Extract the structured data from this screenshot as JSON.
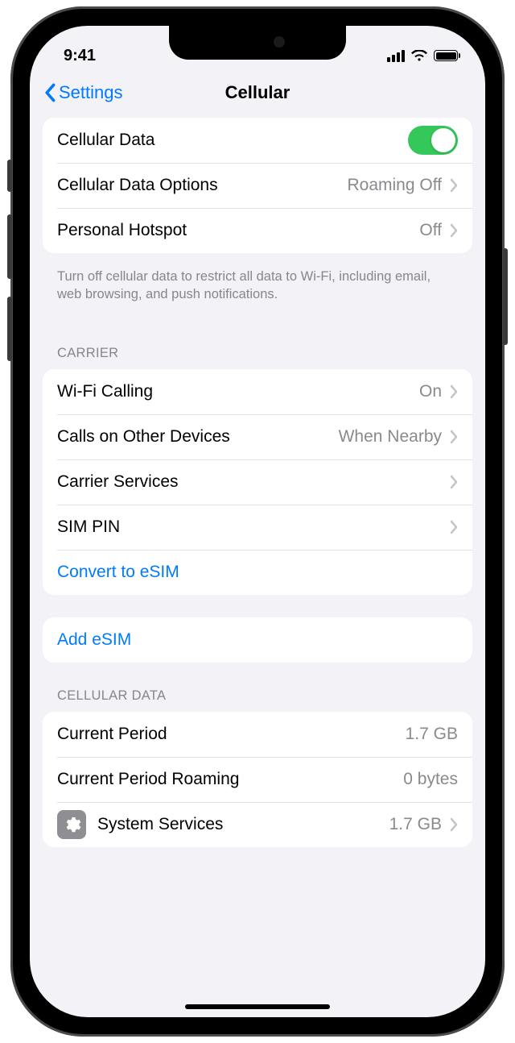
{
  "statusbar": {
    "time": "9:41"
  },
  "nav": {
    "back": "Settings",
    "title": "Cellular"
  },
  "section1": {
    "rows": {
      "cellular_data": {
        "label": "Cellular Data",
        "toggle": true
      },
      "data_options": {
        "label": "Cellular Data Options",
        "value": "Roaming Off"
      },
      "hotspot": {
        "label": "Personal Hotspot",
        "value": "Off"
      }
    },
    "footer": "Turn off cellular data to restrict all data to Wi-Fi, including email, web browsing, and push notifications."
  },
  "section2": {
    "header": "CARRIER",
    "rows": {
      "wifi_calling": {
        "label": "Wi-Fi Calling",
        "value": "On"
      },
      "calls_other": {
        "label": "Calls on Other Devices",
        "value": "When Nearby"
      },
      "carrier_svc": {
        "label": "Carrier Services"
      },
      "sim_pin": {
        "label": "SIM PIN"
      },
      "convert_esim": {
        "label": "Convert to eSIM"
      }
    }
  },
  "section3": {
    "rows": {
      "add_esim": {
        "label": "Add eSIM"
      }
    }
  },
  "section4": {
    "header": "CELLULAR DATA",
    "rows": {
      "current_period": {
        "label": "Current Period",
        "value": "1.7 GB"
      },
      "current_roaming": {
        "label": "Current Period Roaming",
        "value": "0 bytes"
      },
      "system_services": {
        "label": "System Services",
        "value": "1.7 GB"
      }
    }
  }
}
